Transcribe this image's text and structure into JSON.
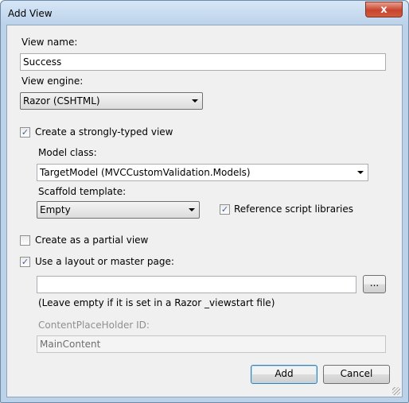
{
  "window": {
    "title": "Add View",
    "close_glyph": "x"
  },
  "form": {
    "view_name_label": "View name:",
    "view_name_value": "Success",
    "view_engine_label": "View engine:",
    "view_engine_value": "Razor (CSHTML)",
    "strongly_typed_label": "Create a strongly-typed view",
    "strongly_typed_checked": true,
    "model_class_label": "Model class:",
    "model_class_value": "TargetModel (MVCCustomValidation.Models)",
    "scaffold_label": "Scaffold template:",
    "scaffold_value": "Empty",
    "reference_scripts_label": "Reference script libraries",
    "reference_scripts_checked": true,
    "partial_view_label": "Create as a partial view",
    "partial_view_checked": false,
    "layout_label": "Use a layout or master page:",
    "layout_checked": true,
    "layout_value": "",
    "browse_label": "...",
    "layout_hint": "(Leave empty if it is set in a Razor _viewstart file)",
    "placeholder_id_label": "ContentPlaceHolder ID:",
    "placeholder_id_value": "MainContent"
  },
  "buttons": {
    "add": "Add",
    "cancel": "Cancel"
  },
  "icons": {
    "check": "checkmark-icon",
    "dropdown": "chevron-down-icon"
  }
}
